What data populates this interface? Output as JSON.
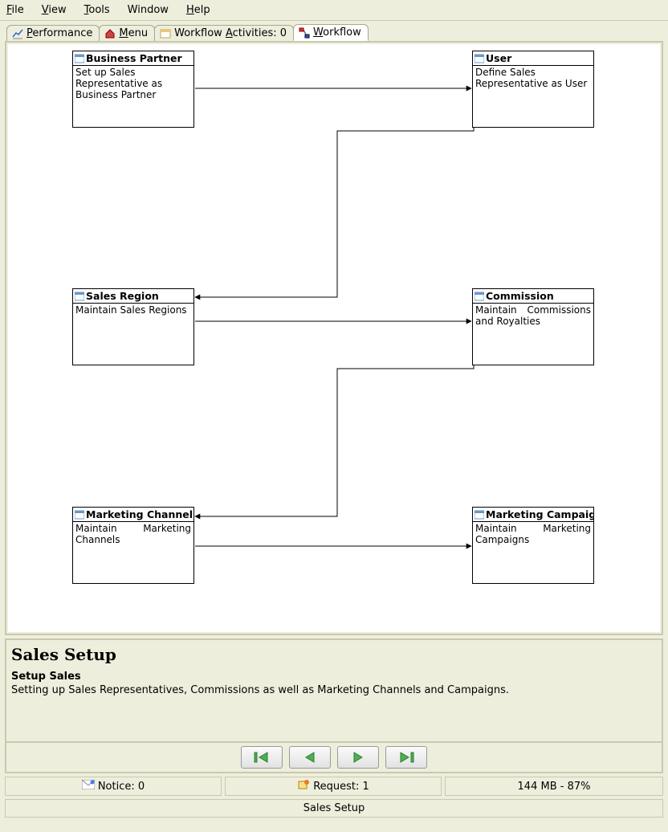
{
  "menu": {
    "file": "File",
    "view": "View",
    "tools": "Tools",
    "window": "Window",
    "help": "Help"
  },
  "tabs": {
    "performance": "Performance",
    "menu": "Menu",
    "activities_prefix": "Workflow ",
    "activities_label": "Activities: 0",
    "workflow": "Workflow"
  },
  "nodes": {
    "bp": {
      "title": "Business Partner",
      "desc": "Set up Sales Representative as Business Partner"
    },
    "user": {
      "title": "User",
      "desc": "Define Sales Representative as User"
    },
    "sr": {
      "title": "Sales Region",
      "desc": "Maintain Sales Regions"
    },
    "com": {
      "title": "Commission",
      "desc": "Maintain Commissions and Royalties"
    },
    "mc": {
      "title": "Marketing Channel",
      "desc": "Maintain Marketing Channels"
    },
    "mcp": {
      "title": "Marketing Campaign",
      "desc": "Maintain Marketing Campaigns"
    }
  },
  "panel": {
    "title": "Sales Setup",
    "subtitle": "Setup Sales",
    "body": "Setting up Sales Representatives, Commissions as well as Marketing Channels and Campaigns."
  },
  "status": {
    "notice": "Notice: 0",
    "request": "Request: 1",
    "mem": "144 MB - 87%"
  },
  "footer": "Sales Setup",
  "chart_data": {
    "type": "flowchart",
    "nodes": [
      {
        "id": "bp",
        "label": "Business Partner",
        "desc": "Set up Sales Representative as Business Partner",
        "row": 0,
        "col": 0
      },
      {
        "id": "user",
        "label": "User",
        "desc": "Define Sales Representative as User",
        "row": 0,
        "col": 1
      },
      {
        "id": "sr",
        "label": "Sales Region",
        "desc": "Maintain Sales Regions",
        "row": 1,
        "col": 0
      },
      {
        "id": "com",
        "label": "Commission",
        "desc": "Maintain Commissions and Royalties",
        "row": 1,
        "col": 1
      },
      {
        "id": "mc",
        "label": "Marketing Channel",
        "desc": "Maintain Marketing Channels",
        "row": 2,
        "col": 0
      },
      {
        "id": "mcp",
        "label": "Marketing Campaign",
        "desc": "Maintain Marketing Campaigns",
        "row": 2,
        "col": 1
      }
    ],
    "edges": [
      {
        "from": "bp",
        "to": "user"
      },
      {
        "from": "user",
        "to": "sr"
      },
      {
        "from": "sr",
        "to": "com"
      },
      {
        "from": "com",
        "to": "mc"
      },
      {
        "from": "mc",
        "to": "mcp"
      }
    ]
  }
}
